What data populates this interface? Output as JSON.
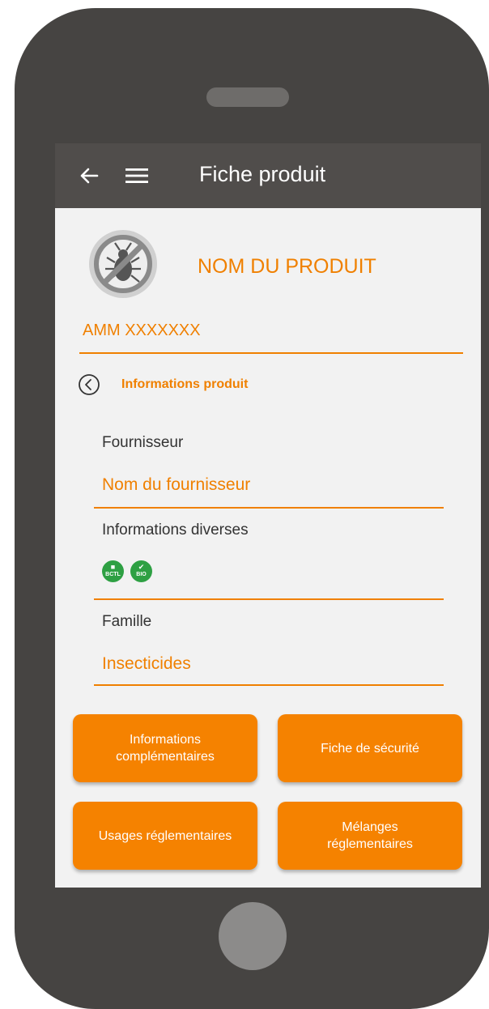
{
  "appbar": {
    "title": "Fiche produit",
    "back_icon": "arrow-left-icon",
    "menu_icon": "hamburger-menu-icon"
  },
  "product": {
    "icon": "no-insect-icon",
    "name": "NOM DU PRODUIT",
    "amm": "AMM XXXXXXX"
  },
  "section": {
    "back_icon": "circle-chevron-left-icon",
    "title": "Informations produit"
  },
  "fields": {
    "supplier_label": "Fournisseur",
    "supplier_value": "Nom du fournisseur",
    "misc_label": "Informations diverses",
    "badges": [
      {
        "icon": "biocontrol-badge-icon",
        "text": "BCTL"
      },
      {
        "icon": "organic-badge-icon",
        "text": "BIO"
      }
    ],
    "family_label": "Famille",
    "family_value": "Insecticides"
  },
  "buttons": {
    "complementary_info": "Informations\ncomplémentaires",
    "safety_sheet": "Fiche de sécurité",
    "regulatory_uses": "Usages réglementaires",
    "regulatory_mixtures": "Mélanges\nréglementaires"
  },
  "colors": {
    "accent": "#f08000",
    "button": "#f58200",
    "appbar": "#504d4b",
    "phone_body": "#464442",
    "screen_bg": "#f2f2f2",
    "badge_green": "#2ea043"
  }
}
